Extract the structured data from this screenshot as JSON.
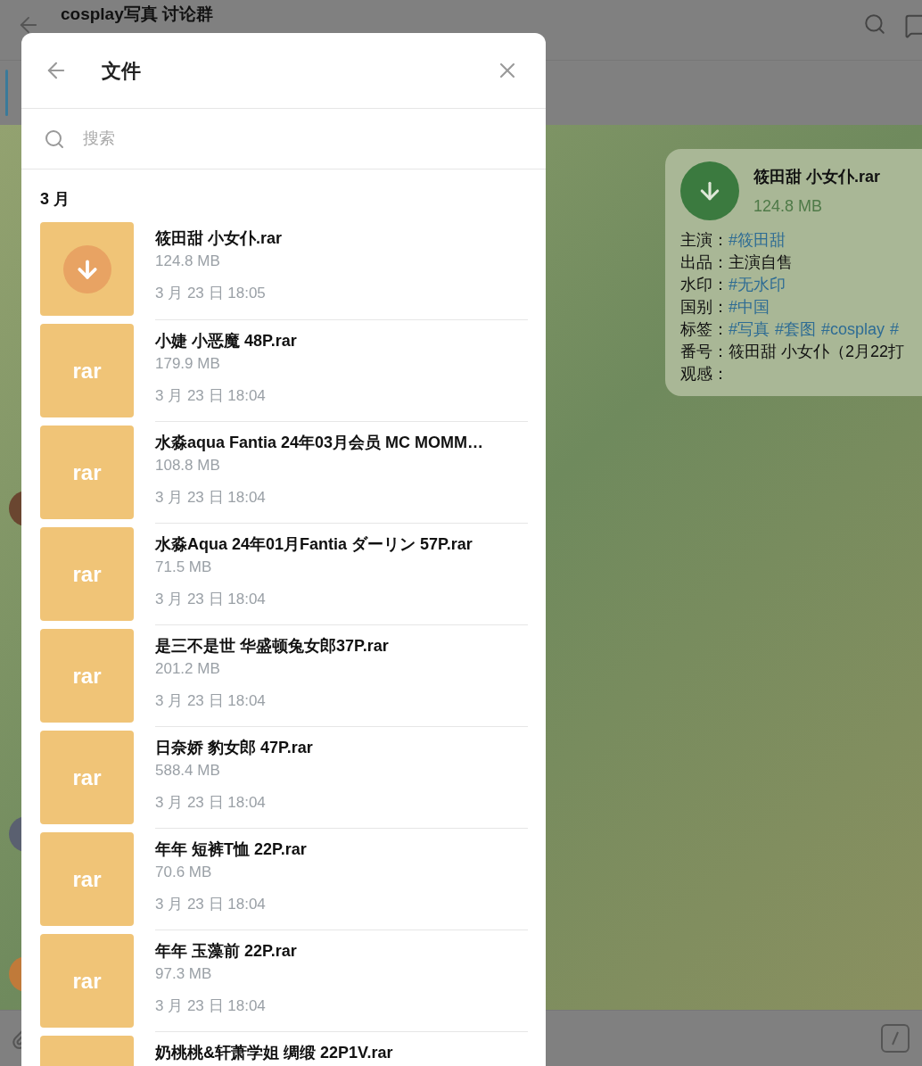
{
  "chat": {
    "title": "cosplay写真 讨论群"
  },
  "message": {
    "file_name": "筱田甜 小女仆.rar",
    "file_size": "124.8 MB",
    "lines": [
      {
        "label": "主演：",
        "parts": [
          {
            "text": "#筱田甜",
            "kind": "hashtag"
          }
        ]
      },
      {
        "label": "出品：",
        "parts": [
          {
            "text": "主演自售",
            "kind": "plain"
          }
        ]
      },
      {
        "label": "水印：",
        "parts": [
          {
            "text": "#无水印",
            "kind": "hashtag"
          }
        ]
      },
      {
        "label": "国别：",
        "parts": [
          {
            "text": "#中国",
            "kind": "hashtag"
          }
        ]
      },
      {
        "label": "标签：",
        "parts": [
          {
            "text": "#写真",
            "kind": "hashtag"
          },
          {
            "text": "#套图",
            "kind": "hashtag"
          },
          {
            "text": "#cosplay",
            "kind": "hashtag"
          },
          {
            "text": "#",
            "kind": "hashtag"
          }
        ]
      },
      {
        "label": "番号：",
        "parts": [
          {
            "text": "筱田甜 小女仆（2月22打",
            "kind": "plain"
          }
        ]
      },
      {
        "label": "观感："
      }
    ]
  },
  "dialog": {
    "title": "文件",
    "search": {
      "placeholder": "搜索"
    },
    "section": "3 月",
    "files": [
      {
        "kind": "download",
        "name": "筱田甜 小女仆.rar",
        "size": "124.8 MB",
        "date": "3 月 23 日 18:05"
      },
      {
        "kind": "ext",
        "ext": "rar",
        "name": "小婕 小恶魔 48P.rar",
        "size": "179.9 MB",
        "date": "3 月 23 日 18:04"
      },
      {
        "kind": "ext",
        "ext": "rar",
        "name": "水淼aqua Fantia 24年03月会员 MC MOMM…",
        "size": "108.8 MB",
        "date": "3 月 23 日 18:04"
      },
      {
        "kind": "ext",
        "ext": "rar",
        "name": "水淼Aqua 24年01月Fantia ダーリン 57P.rar",
        "size": "71.5 MB",
        "date": "3 月 23 日 18:04"
      },
      {
        "kind": "ext",
        "ext": "rar",
        "name": "是三不是世 华盛顿兔女郎37P.rar",
        "size": "201.2 MB",
        "date": "3 月 23 日 18:04"
      },
      {
        "kind": "ext",
        "ext": "rar",
        "name": "日奈娇 豹女郎 47P.rar",
        "size": "588.4 MB",
        "date": "3 月 23 日 18:04"
      },
      {
        "kind": "ext",
        "ext": "rar",
        "name": "年年 短裤T恤 22P.rar",
        "size": "70.6 MB",
        "date": "3 月 23 日 18:04"
      },
      {
        "kind": "ext",
        "ext": "rar",
        "name": "年年 玉藻前 22P.rar",
        "size": "97.3 MB",
        "date": "3 月 23 日 18:04"
      },
      {
        "kind": "ext",
        "name": "奶桃桃&轩萧学姐 绸缎 22P1V.rar"
      }
    ]
  }
}
